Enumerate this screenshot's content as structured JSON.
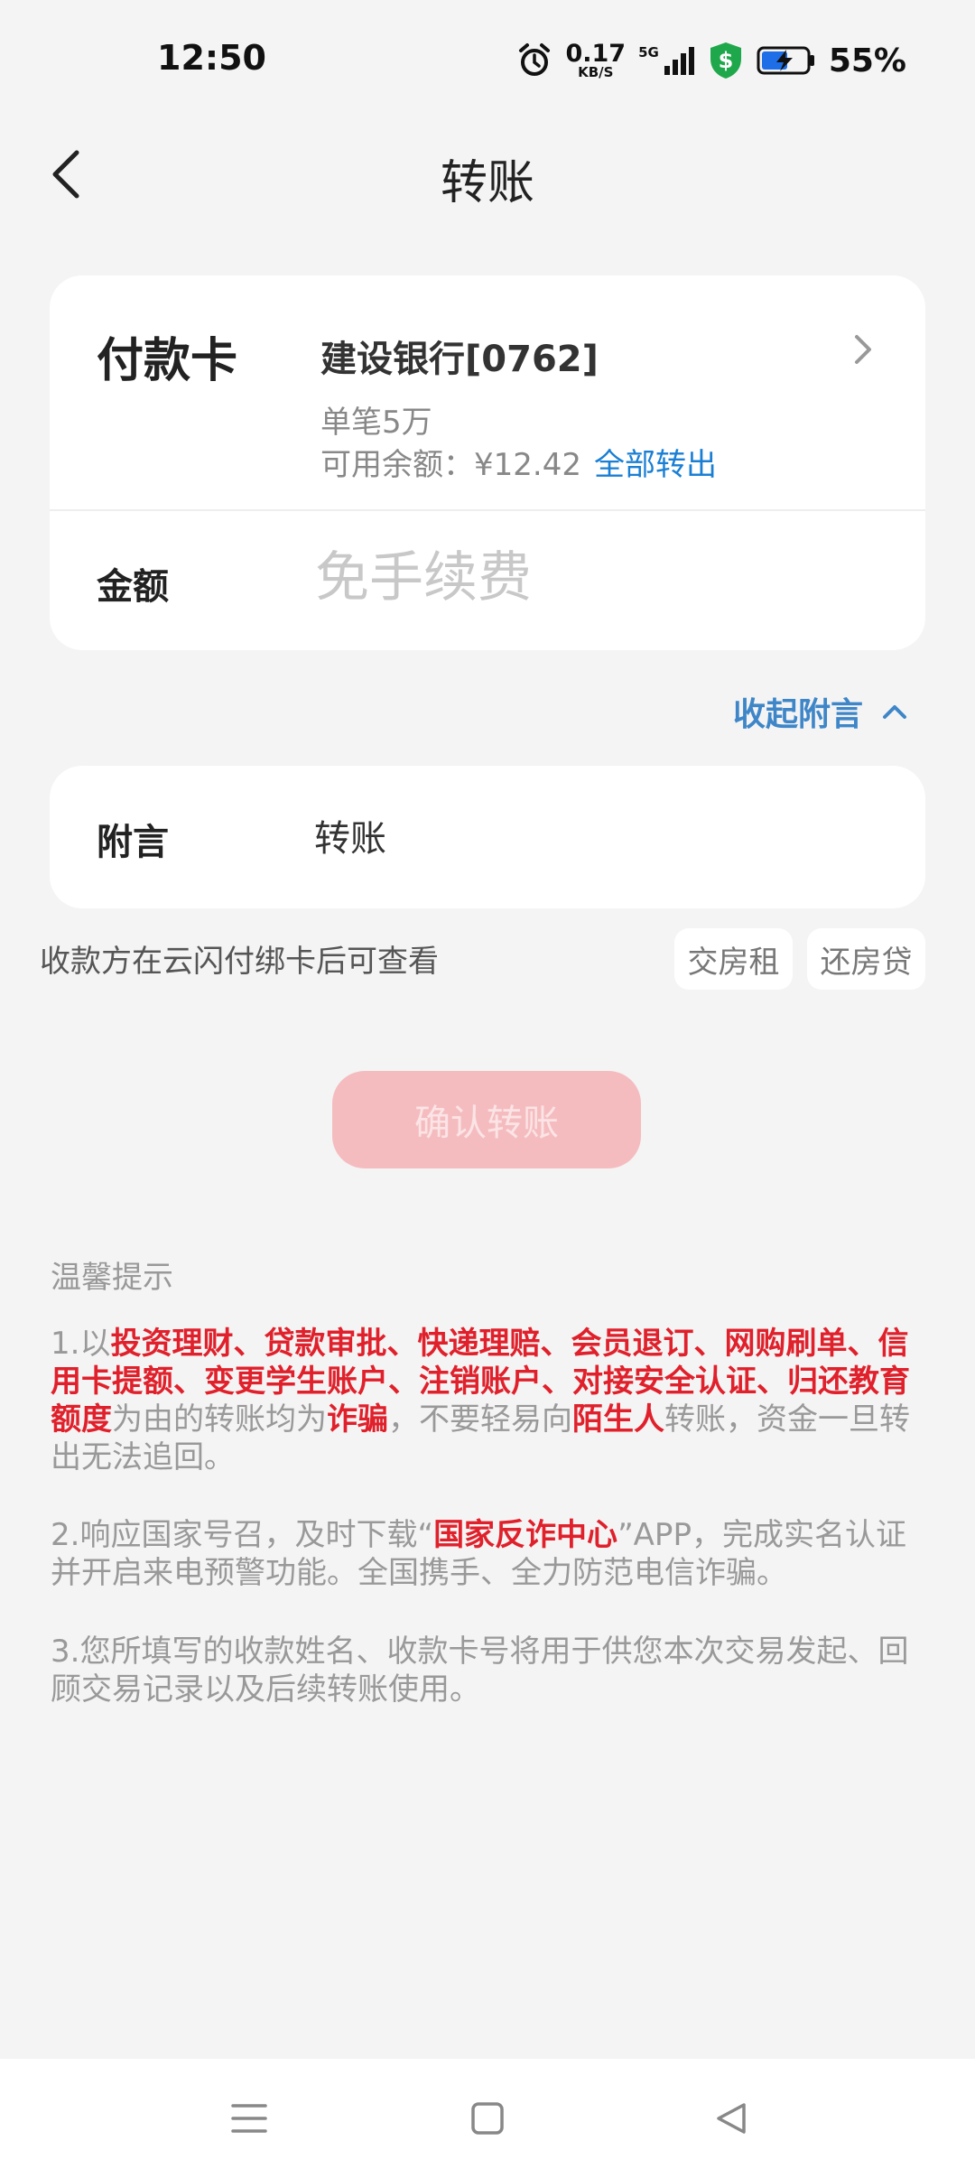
{
  "status_bar": {
    "time": "12:50",
    "net_speed_value": "0.17",
    "net_speed_unit": "KB/S",
    "network": "5G",
    "battery": "55%"
  },
  "header": {
    "title": "转账"
  },
  "pay_card": {
    "label": "付款卡",
    "bank": "建设银行[0762]",
    "limit": "单笔5万",
    "balance": "可用余额：¥12.42",
    "transfer_all": "全部转出"
  },
  "amount": {
    "label": "金额",
    "placeholder": "免手续费"
  },
  "collapse_label": "收起附言",
  "memo": {
    "label": "附言",
    "value": "转账"
  },
  "memo_note": "收款方在云闪付绑卡后可查看",
  "chips": [
    "交房租",
    "还房贷"
  ],
  "confirm_label": "确认转账",
  "tips": {
    "title": "温馨提示",
    "tip1": {
      "p1": "1.以",
      "r1": "投资理财、贷款审批、快递理赔、会员退订、网购刷单、信用卡提额、变更学生账户、注销账户、对接安全认证、归还教育额度",
      "p2": "为由的转账均为",
      "r2": "诈骗",
      "p3": "，不要轻易向",
      "r3": "陌生人",
      "p4": "转账，资金一旦转出无法追回。"
    },
    "tip2": {
      "p1": "2.响应国家号召，及时下载“",
      "r1": "国家反诈中心",
      "p2": "”APP，完成实名认证并开启来电预警功能。全国携手、全力防范电信诈骗。"
    },
    "tip3": "3.您所填写的收款姓名、收款卡号将用于供您本次交易发起、回顾交易记录以及后续转账使用。"
  },
  "colors": {
    "accent_blue": "#1a7fd4",
    "warning_red": "#e0202b",
    "confirm_disabled": "#f5bcc0"
  }
}
